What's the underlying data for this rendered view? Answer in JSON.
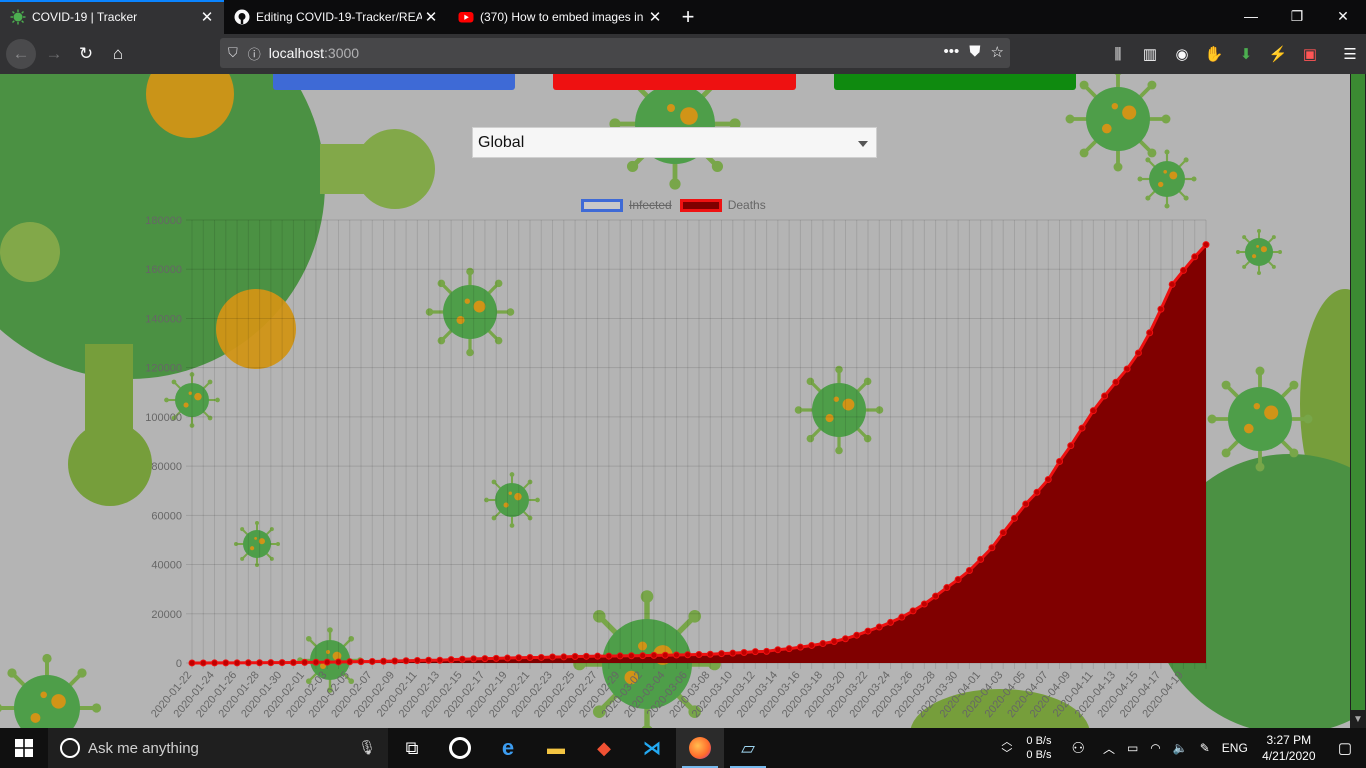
{
  "browser": {
    "tabs": [
      {
        "title": "COVID-19 | Tracker",
        "active": true,
        "icon": "virus-icon"
      },
      {
        "title": "Editing COVID-19-Tracker/REA",
        "active": false,
        "icon": "github-icon"
      },
      {
        "title": "(370) How to embed images in",
        "active": false,
        "icon": "youtube-icon"
      }
    ],
    "url_host": "localhost",
    "url_port": ":3000"
  },
  "page": {
    "country_select": {
      "value": "Global"
    },
    "cards": [
      {
        "color": "#3e6ad6"
      },
      {
        "color": "#ee1111"
      },
      {
        "color": "#0f8a0f"
      }
    ]
  },
  "chart_data": {
    "type": "line",
    "legend": [
      {
        "label": "Infected",
        "hidden": true,
        "border": "#3e6ad6",
        "fill": "#c8c8c8"
      },
      {
        "label": "Deaths",
        "hidden": false,
        "border": "#ee1111",
        "fill": "#800000"
      }
    ],
    "ylim": [
      0,
      180000
    ],
    "yticks": [
      0,
      20000,
      40000,
      60000,
      80000,
      100000,
      120000,
      140000,
      160000,
      180000
    ],
    "xtick_labels": [
      "2020-01-22",
      "2020-01-24",
      "2020-01-26",
      "2020-01-28",
      "2020-01-30",
      "2020-02-01",
      "2020-02-03",
      "2020-02-05",
      "2020-02-07",
      "2020-02-09",
      "2020-02-11",
      "2020-02-13",
      "2020-02-15",
      "2020-02-17",
      "2020-02-19",
      "2020-02-21",
      "2020-02-23",
      "2020-02-25",
      "2020-02-27",
      "2020-02-29",
      "2020-03-02",
      "2020-03-04",
      "2020-03-06",
      "2020-03-08",
      "2020-03-10",
      "2020-03-12",
      "2020-03-14",
      "2020-03-16",
      "2020-03-18",
      "2020-03-20",
      "2020-03-22",
      "2020-03-24",
      "2020-03-26",
      "2020-03-28",
      "2020-03-30",
      "2020-04-01",
      "2020-04-03",
      "2020-04-05",
      "2020-04-07",
      "2020-04-09",
      "2020-04-11",
      "2020-04-13",
      "2020-04-15",
      "2020-04-17",
      "2020-04-19"
    ],
    "series": [
      {
        "name": "Deaths",
        "start_date": "2020-01-22",
        "values": [
          17,
          18,
          26,
          42,
          56,
          82,
          106,
          132,
          170,
          213,
          259,
          304,
          362,
          426,
          492,
          564,
          634,
          719,
          806,
          906,
          1013,
          1113,
          1118,
          1371,
          1523,
          1666,
          1770,
          1868,
          2007,
          2122,
          2247,
          2251,
          2458,
          2469,
          2629,
          2708,
          2770,
          2814,
          2872,
          2941,
          2996,
          3085,
          3160,
          3254,
          3348,
          3460,
          3558,
          3803,
          3996,
          4262,
          4615,
          4720,
          5404,
          5819,
          6440,
          7126,
          7905,
          8733,
          9867,
          11299,
          12973,
          14623,
          16497,
          18615,
          21181,
          23970,
          27198,
          30652,
          33925,
          37582,
          42107,
          46809,
          52983,
          58787,
          64606,
          69374,
          74565,
          81865,
          88338,
          95455,
          102525,
          108503,
          114091,
          119482,
          125984,
          134177,
          143800,
          153822,
          159510,
          165044,
          169986
        ]
      }
    ]
  },
  "taskbar": {
    "search_placeholder": "Ask me anything",
    "net_up": "0 B/s",
    "net_down": "0 B/s",
    "lang": "ENG",
    "time": "3:27 PM",
    "date": "4/21/2020"
  }
}
